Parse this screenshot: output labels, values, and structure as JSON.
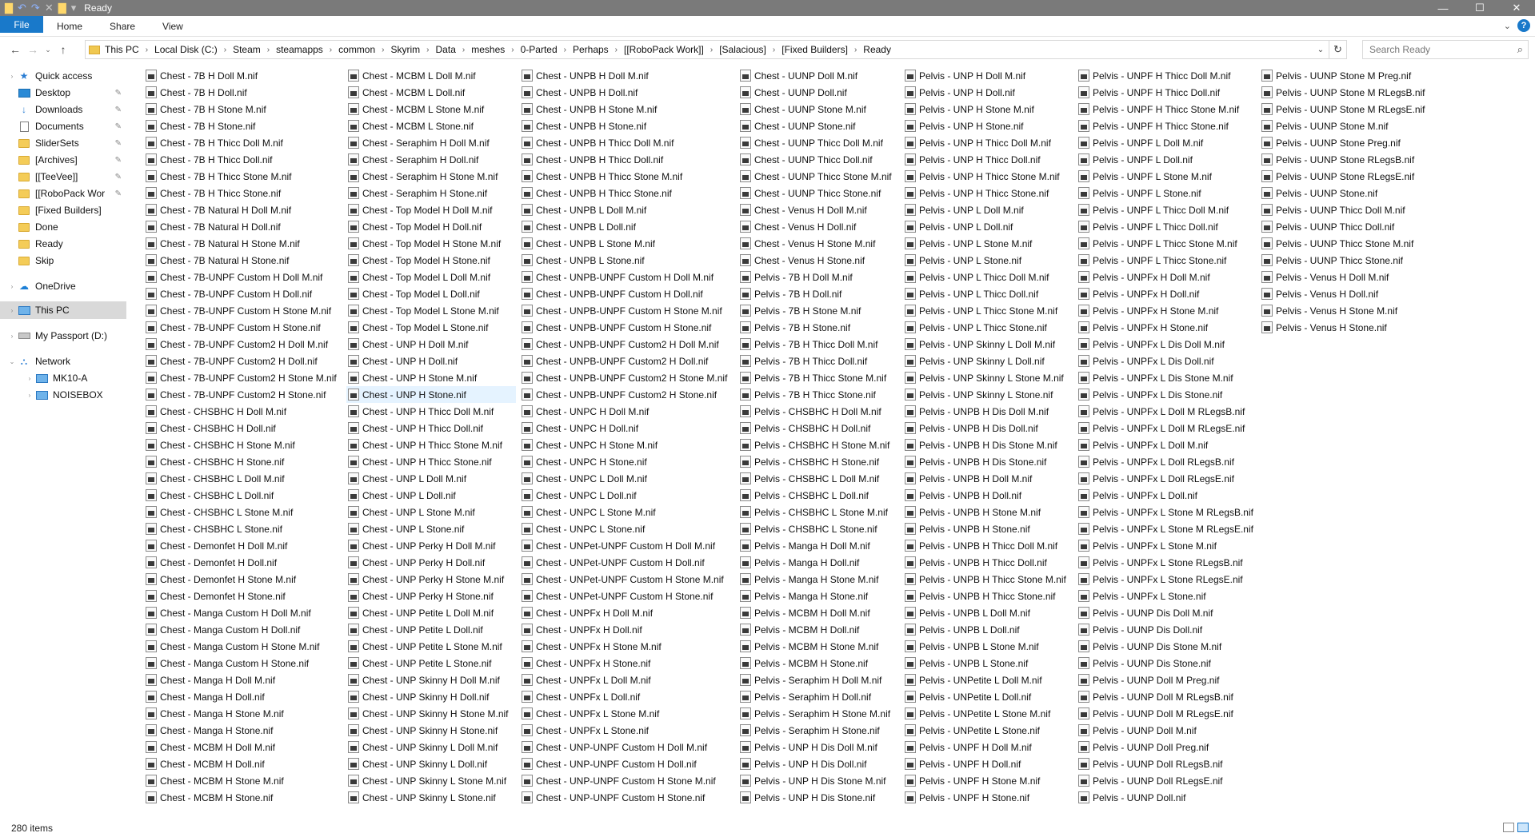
{
  "window": {
    "title": "Ready",
    "controls": {
      "minimize": "—",
      "maximize": "☐",
      "close": "✕"
    }
  },
  "ribbon": {
    "tabs": [
      "File",
      "Home",
      "Share",
      "View"
    ]
  },
  "address": {
    "crumbs": [
      "This PC",
      "Local Disk (C:)",
      "Steam",
      "steamapps",
      "common",
      "Skyrim",
      "Data",
      "meshes",
      "0-Parted",
      "Perhaps",
      "[[RoboPack Work]]",
      "[Salacious]",
      "[Fixed Builders]",
      "Ready"
    ],
    "search_placeholder": "Search Ready"
  },
  "nav_pane": {
    "items": [
      {
        "label": "Quick access",
        "icon": "star-icon",
        "pinned": false
      },
      {
        "label": "Desktop",
        "icon": "desktop-icon",
        "pinned": true
      },
      {
        "label": "Downloads",
        "icon": "download-icon",
        "pinned": true
      },
      {
        "label": "Documents",
        "icon": "documents-icon",
        "pinned": true
      },
      {
        "label": "SliderSets",
        "icon": "folder-icon",
        "pinned": true
      },
      {
        "label": "[Archives]",
        "icon": "folder-icon",
        "pinned": true
      },
      {
        "label": "[[TeeVee]]",
        "icon": "folder-icon",
        "pinned": true
      },
      {
        "label": "[[RoboPack Wor",
        "icon": "folder-icon",
        "pinned": true
      },
      {
        "label": "[Fixed Builders]",
        "icon": "folder-icon",
        "pinned": false
      },
      {
        "label": "Done",
        "icon": "folder-icon",
        "pinned": false
      },
      {
        "label": "Ready",
        "icon": "folder-icon",
        "pinned": false
      },
      {
        "label": "Skip",
        "icon": "folder-icon",
        "pinned": false
      },
      {
        "label": "OneDrive",
        "icon": "cloud-icon",
        "pinned": false
      },
      {
        "label": "This PC",
        "icon": "computer-icon",
        "pinned": false
      },
      {
        "label": "My Passport (D:)",
        "icon": "drive-icon",
        "pinned": false
      },
      {
        "label": "Network",
        "icon": "network-icon",
        "pinned": false
      },
      {
        "label": "MK10-A",
        "icon": "computer-icon",
        "pinned": false
      },
      {
        "label": "NOISEBOX",
        "icon": "computer-icon",
        "pinned": false
      }
    ]
  },
  "files": {
    "selected": "Chest - UNP H Stone.nif",
    "columns": [
      [
        "Chest - 7B H Doll M.nif",
        "Chest - 7B H Doll.nif",
        "Chest - 7B H Stone M.nif",
        "Chest - 7B H Stone.nif",
        "Chest - 7B H Thicc Doll M.nif",
        "Chest - 7B H Thicc Doll.nif",
        "Chest - 7B H Thicc Stone M.nif",
        "Chest - 7B H Thicc Stone.nif",
        "Chest - 7B Natural H Doll M.nif",
        "Chest - 7B Natural H Doll.nif",
        "Chest - 7B Natural H Stone M.nif",
        "Chest - 7B Natural H Stone.nif",
        "Chest - 7B-UNPF Custom H Doll M.nif",
        "Chest - 7B-UNPF Custom H Doll.nif",
        "Chest - 7B-UNPF Custom H Stone M.nif",
        "Chest - 7B-UNPF Custom H Stone.nif",
        "Chest - 7B-UNPF Custom2 H Doll M.nif",
        "Chest - 7B-UNPF Custom2 H Doll.nif",
        "Chest - 7B-UNPF Custom2 H Stone M.nif",
        "Chest - 7B-UNPF Custom2 H Stone.nif",
        "Chest - CHSBHC H Doll M.nif",
        "Chest - CHSBHC H Doll.nif",
        "Chest - CHSBHC H Stone M.nif",
        "Chest - CHSBHC H Stone.nif",
        "Chest - CHSBHC L Doll M.nif",
        "Chest - CHSBHC L Doll.nif",
        "Chest - CHSBHC L Stone M.nif",
        "Chest - CHSBHC L Stone.nif",
        "Chest - Demonfet H Doll M.nif",
        "Chest - Demonfet H Doll.nif",
        "Chest - Demonfet H Stone M.nif",
        "Chest - Demonfet H Stone.nif",
        "Chest - Manga Custom H Doll M.nif",
        "Chest - Manga Custom H Doll.nif",
        "Chest - Manga Custom H Stone M.nif",
        "Chest - Manga Custom H Stone.nif",
        "Chest - Manga H Doll M.nif",
        "Chest - Manga H Doll.nif",
        "Chest - Manga H Stone M.nif",
        "Chest - Manga H Stone.nif",
        "Chest - MCBM H Doll M.nif",
        "Chest - MCBM H Doll.nif",
        "Chest - MCBM H Stone M.nif",
        "Chest - MCBM H Stone.nif"
      ],
      [
        "Chest - MCBM L Doll M.nif",
        "Chest - MCBM L Doll.nif",
        "Chest - MCBM L Stone M.nif",
        "Chest - MCBM L Stone.nif",
        "Chest - Seraphim H Doll M.nif",
        "Chest - Seraphim H Doll.nif",
        "Chest - Seraphim H Stone M.nif",
        "Chest - Seraphim H Stone.nif",
        "Chest - Top Model H Doll M.nif",
        "Chest - Top Model H Doll.nif",
        "Chest - Top Model H Stone M.nif",
        "Chest - Top Model H Stone.nif",
        "Chest - Top Model L Doll M.nif",
        "Chest - Top Model L Doll.nif",
        "Chest - Top Model L Stone M.nif",
        "Chest - Top Model L Stone.nif",
        "Chest - UNP H Doll M.nif",
        "Chest - UNP H Doll.nif",
        "Chest - UNP H Stone M.nif",
        "Chest - UNP H Stone.nif",
        "Chest - UNP H Thicc Doll M.nif",
        "Chest - UNP H Thicc Doll.nif",
        "Chest - UNP H Thicc Stone M.nif",
        "Chest - UNP H Thicc Stone.nif",
        "Chest - UNP L Doll M.nif",
        "Chest - UNP L Doll.nif",
        "Chest - UNP L Stone M.nif",
        "Chest - UNP L Stone.nif",
        "Chest - UNP Perky H Doll M.nif",
        "Chest - UNP Perky H Doll.nif",
        "Chest - UNP Perky H Stone M.nif",
        "Chest - UNP Perky H Stone.nif",
        "Chest - UNP Petite L Doll M.nif",
        "Chest - UNP Petite L Doll.nif",
        "Chest - UNP Petite L Stone M.nif",
        "Chest - UNP Petite L Stone.nif",
        "Chest - UNP Skinny H Doll M.nif",
        "Chest - UNP Skinny H Doll.nif",
        "Chest - UNP Skinny H Stone M.nif",
        "Chest - UNP Skinny H Stone.nif",
        "Chest - UNP Skinny L Doll M.nif",
        "Chest - UNP Skinny L Doll.nif",
        "Chest - UNP Skinny L Stone M.nif",
        "Chest - UNP Skinny L Stone.nif"
      ],
      [
        "Chest - UNPB H Doll M.nif",
        "Chest - UNPB H Doll.nif",
        "Chest - UNPB H Stone M.nif",
        "Chest - UNPB H Stone.nif",
        "Chest - UNPB H Thicc Doll M.nif",
        "Chest - UNPB H Thicc Doll.nif",
        "Chest - UNPB H Thicc Stone M.nif",
        "Chest - UNPB H Thicc Stone.nif",
        "Chest - UNPB L Doll M.nif",
        "Chest - UNPB L Doll.nif",
        "Chest - UNPB L Stone M.nif",
        "Chest - UNPB L Stone.nif",
        "Chest - UNPB-UNPF Custom H Doll M.nif",
        "Chest - UNPB-UNPF Custom H Doll.nif",
        "Chest - UNPB-UNPF Custom H Stone M.nif",
        "Chest - UNPB-UNPF Custom H Stone.nif",
        "Chest - UNPB-UNPF Custom2 H Doll M.nif",
        "Chest - UNPB-UNPF Custom2 H Doll.nif",
        "Chest - UNPB-UNPF Custom2 H Stone M.nif",
        "Chest - UNPB-UNPF Custom2 H Stone.nif",
        "Chest - UNPC H Doll M.nif",
        "Chest - UNPC H Doll.nif",
        "Chest - UNPC H Stone M.nif",
        "Chest - UNPC H Stone.nif",
        "Chest - UNPC L Doll M.nif",
        "Chest - UNPC L Doll.nif",
        "Chest - UNPC L Stone M.nif",
        "Chest - UNPC L Stone.nif",
        "Chest - UNPet-UNPF Custom H Doll M.nif",
        "Chest - UNPet-UNPF Custom H Doll.nif",
        "Chest - UNPet-UNPF Custom H Stone M.nif",
        "Chest - UNPet-UNPF Custom H Stone.nif",
        "Chest - UNPFx H Doll M.nif",
        "Chest - UNPFx H Doll.nif",
        "Chest - UNPFx H Stone M.nif",
        "Chest - UNPFx H Stone.nif",
        "Chest - UNPFx L Doll M.nif",
        "Chest - UNPFx L Doll.nif",
        "Chest - UNPFx L Stone M.nif",
        "Chest - UNPFx L Stone.nif",
        "Chest - UNP-UNPF Custom H Doll M.nif",
        "Chest - UNP-UNPF Custom H Doll.nif",
        "Chest - UNP-UNPF Custom H Stone M.nif",
        "Chest - UNP-UNPF Custom H Stone.nif"
      ],
      [
        "Chest - UUNP Doll M.nif",
        "Chest - UUNP Doll.nif",
        "Chest - UUNP Stone M.nif",
        "Chest - UUNP Stone.nif",
        "Chest - UUNP Thicc Doll M.nif",
        "Chest - UUNP Thicc Doll.nif",
        "Chest - UUNP Thicc Stone M.nif",
        "Chest - UUNP Thicc Stone.nif",
        "Chest - Venus H Doll M.nif",
        "Chest - Venus H Doll.nif",
        "Chest - Venus H Stone M.nif",
        "Chest - Venus H Stone.nif",
        "Pelvis - 7B H Doll M.nif",
        "Pelvis - 7B H Doll.nif",
        "Pelvis - 7B H Stone M.nif",
        "Pelvis - 7B H Stone.nif",
        "Pelvis - 7B H Thicc Doll M.nif",
        "Pelvis - 7B H Thicc Doll.nif",
        "Pelvis - 7B H Thicc Stone M.nif",
        "Pelvis - 7B H Thicc Stone.nif",
        "Pelvis - CHSBHC H Doll M.nif",
        "Pelvis - CHSBHC H Doll.nif",
        "Pelvis - CHSBHC H Stone M.nif",
        "Pelvis - CHSBHC H Stone.nif",
        "Pelvis - CHSBHC L Doll M.nif",
        "Pelvis - CHSBHC L Doll.nif",
        "Pelvis - CHSBHC L Stone M.nif",
        "Pelvis - CHSBHC L Stone.nif",
        "Pelvis - Manga H Doll M.nif",
        "Pelvis - Manga H Doll.nif",
        "Pelvis - Manga H Stone M.nif",
        "Pelvis - Manga H Stone.nif",
        "Pelvis - MCBM H Doll M.nif",
        "Pelvis - MCBM H Doll.nif",
        "Pelvis - MCBM H Stone M.nif",
        "Pelvis - MCBM H Stone.nif",
        "Pelvis - Seraphim H Doll M.nif",
        "Pelvis - Seraphim H Doll.nif",
        "Pelvis - Seraphim H Stone M.nif",
        "Pelvis - Seraphim H Stone.nif",
        "Pelvis - UNP H Dis Doll M.nif",
        "Pelvis - UNP H Dis Doll.nif",
        "Pelvis - UNP H Dis Stone M.nif",
        "Pelvis - UNP H Dis Stone.nif"
      ],
      [
        "Pelvis - UNP H Doll M.nif",
        "Pelvis - UNP H Doll.nif",
        "Pelvis - UNP H Stone M.nif",
        "Pelvis - UNP H Stone.nif",
        "Pelvis - UNP H Thicc Doll M.nif",
        "Pelvis - UNP H Thicc Doll.nif",
        "Pelvis - UNP H Thicc Stone M.nif",
        "Pelvis - UNP H Thicc Stone.nif",
        "Pelvis - UNP L Doll M.nif",
        "Pelvis - UNP L Doll.nif",
        "Pelvis - UNP L Stone M.nif",
        "Pelvis - UNP L Stone.nif",
        "Pelvis - UNP L Thicc Doll M.nif",
        "Pelvis - UNP L Thicc Doll.nif",
        "Pelvis - UNP L Thicc Stone M.nif",
        "Pelvis - UNP L Thicc Stone.nif",
        "Pelvis - UNP Skinny L Doll M.nif",
        "Pelvis - UNP Skinny L Doll.nif",
        "Pelvis - UNP Skinny L Stone M.nif",
        "Pelvis - UNP Skinny L Stone.nif",
        "Pelvis - UNPB H Dis Doll M.nif",
        "Pelvis - UNPB H Dis Doll.nif",
        "Pelvis - UNPB H Dis Stone M.nif",
        "Pelvis - UNPB H Dis Stone.nif",
        "Pelvis - UNPB H Doll M.nif",
        "Pelvis - UNPB H Doll.nif",
        "Pelvis - UNPB H Stone M.nif",
        "Pelvis - UNPB H Stone.nif",
        "Pelvis - UNPB H Thicc Doll M.nif",
        "Pelvis - UNPB H Thicc Doll.nif",
        "Pelvis - UNPB H Thicc Stone M.nif",
        "Pelvis - UNPB H Thicc Stone.nif",
        "Pelvis - UNPB L Doll M.nif",
        "Pelvis - UNPB L Doll.nif",
        "Pelvis - UNPB L Stone M.nif",
        "Pelvis - UNPB L Stone.nif",
        "Pelvis - UNPetite L Doll M.nif",
        "Pelvis - UNPetite L Doll.nif",
        "Pelvis - UNPetite L Stone M.nif",
        "Pelvis - UNPetite L Stone.nif",
        "Pelvis - UNPF H Doll M.nif",
        "Pelvis - UNPF H Doll.nif",
        "Pelvis - UNPF H Stone M.nif",
        "Pelvis - UNPF H Stone.nif"
      ],
      [
        "Pelvis - UNPF H Thicc Doll M.nif",
        "Pelvis - UNPF H Thicc Doll.nif",
        "Pelvis - UNPF H Thicc Stone M.nif",
        "Pelvis - UNPF H Thicc Stone.nif",
        "Pelvis - UNPF L Doll M.nif",
        "Pelvis - UNPF L Doll.nif",
        "Pelvis - UNPF L Stone M.nif",
        "Pelvis - UNPF L Stone.nif",
        "Pelvis - UNPF L Thicc Doll M.nif",
        "Pelvis - UNPF L Thicc Doll.nif",
        "Pelvis - UNPF L Thicc Stone M.nif",
        "Pelvis - UNPF L Thicc Stone.nif",
        "Pelvis - UNPFx H Doll M.nif",
        "Pelvis - UNPFx H Doll.nif",
        "Pelvis - UNPFx H Stone M.nif",
        "Pelvis - UNPFx H Stone.nif",
        "Pelvis - UNPFx L Dis Doll M.nif",
        "Pelvis - UNPFx L Dis Doll.nif",
        "Pelvis - UNPFx L Dis Stone M.nif",
        "Pelvis - UNPFx L Dis Stone.nif",
        "Pelvis - UNPFx L Doll M RLegsB.nif",
        "Pelvis - UNPFx L Doll M RLegsE.nif",
        "Pelvis - UNPFx L Doll M.nif",
        "Pelvis - UNPFx L Doll RLegsB.nif",
        "Pelvis - UNPFx L Doll RLegsE.nif",
        "Pelvis - UNPFx L Doll.nif",
        "Pelvis - UNPFx L Stone M RLegsB.nif",
        "Pelvis - UNPFx L Stone M RLegsE.nif",
        "Pelvis - UNPFx L Stone M.nif",
        "Pelvis - UNPFx L Stone RLegsB.nif",
        "Pelvis - UNPFx L Stone RLegsE.nif",
        "Pelvis - UNPFx L Stone.nif",
        "Pelvis - UUNP Dis Doll M.nif",
        "Pelvis - UUNP Dis Doll.nif",
        "Pelvis - UUNP Dis Stone M.nif",
        "Pelvis - UUNP Dis Stone.nif",
        "Pelvis - UUNP Doll M Preg.nif",
        "Pelvis - UUNP Doll M RLegsB.nif",
        "Pelvis - UUNP Doll M RLegsE.nif",
        "Pelvis - UUNP Doll M.nif",
        "Pelvis - UUNP Doll Preg.nif",
        "Pelvis - UUNP Doll RLegsB.nif",
        "Pelvis - UUNP Doll RLegsE.nif",
        "Pelvis - UUNP Doll.nif"
      ],
      [
        "Pelvis - UUNP Stone M Preg.nif",
        "Pelvis - UUNP Stone M RLegsB.nif",
        "Pelvis - UUNP Stone M RLegsE.nif",
        "Pelvis - UUNP Stone M.nif",
        "Pelvis - UUNP Stone Preg.nif",
        "Pelvis - UUNP Stone RLegsB.nif",
        "Pelvis - UUNP Stone RLegsE.nif",
        "Pelvis - UUNP Stone.nif",
        "Pelvis - UUNP Thicc Doll M.nif",
        "Pelvis - UUNP Thicc Doll.nif",
        "Pelvis - UUNP Thicc Stone M.nif",
        "Pelvis - UUNP Thicc Stone.nif",
        "Pelvis - Venus H Doll M.nif",
        "Pelvis - Venus H Doll.nif",
        "Pelvis - Venus H Stone M.nif",
        "Pelvis - Venus H Stone.nif"
      ]
    ]
  },
  "status": {
    "item_count": "280 items"
  }
}
